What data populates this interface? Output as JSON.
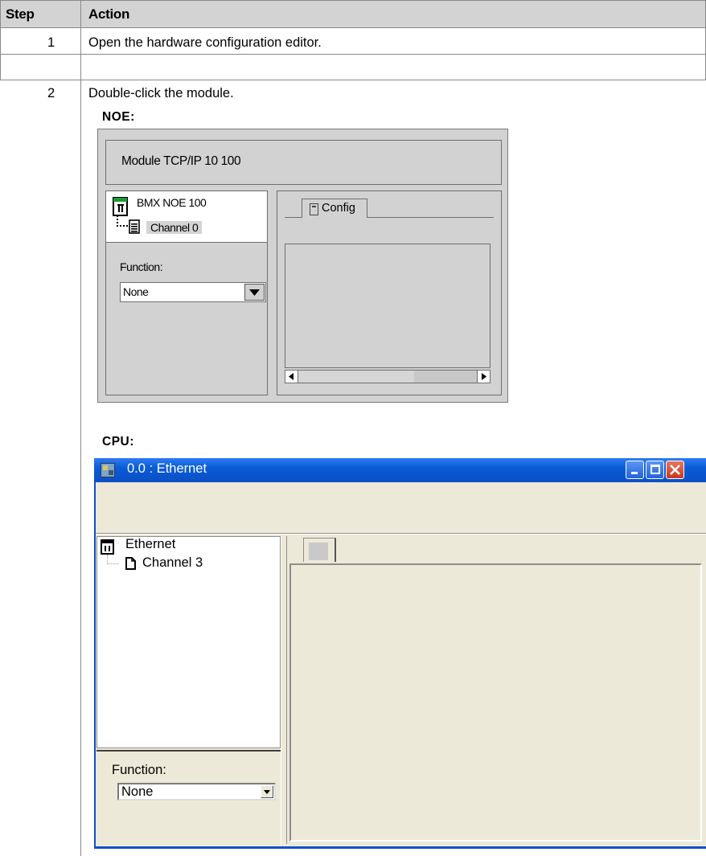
{
  "table": {
    "headers": {
      "step": "Step",
      "action": "Action"
    },
    "rows": [
      {
        "step": "1",
        "action": "Open the hardware configuration editor."
      },
      {
        "step": "2",
        "action": "Double-click the module."
      }
    ]
  },
  "noe": {
    "section_label": "NOE:",
    "module_title": "Module TCP/IP 10 100",
    "tree_module": "BMX NOE 100",
    "tree_channel": "Channel 0",
    "function_label": "Function:",
    "function_value": "None",
    "tab_label": "Config"
  },
  "cpu": {
    "section_label": "CPU:",
    "window_title": "0.0 : Ethernet",
    "tree_root": "Ethernet",
    "tree_channel": "Channel 3",
    "function_label": "Function:",
    "function_value": "None"
  },
  "colors": {
    "header_bg": "#d3d3d3",
    "titlebar_blue": "#0a5cd6",
    "close_red": "#d8452c",
    "panel_gray": "#d2d2d2",
    "window_beige": "#ece9d8"
  }
}
